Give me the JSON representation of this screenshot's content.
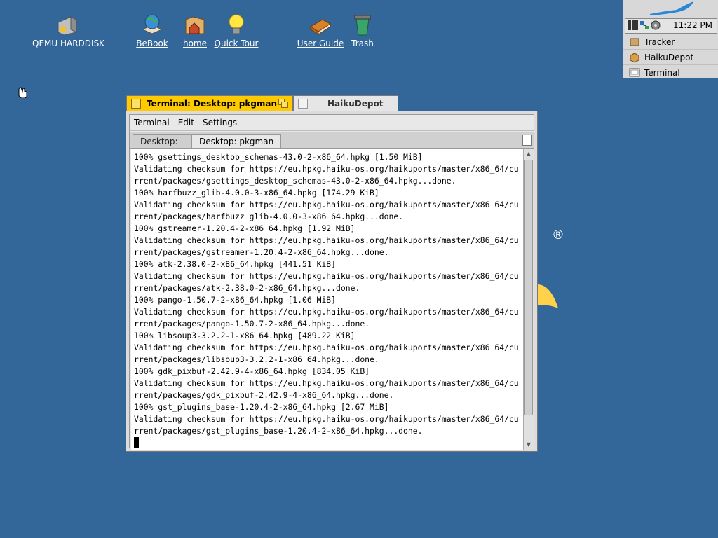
{
  "desktop": {
    "icons": [
      {
        "label": "QEMU HARDDISK",
        "icon": "harddisk-icon"
      },
      {
        "label": "BeBook",
        "icon": "bebook-icon"
      },
      {
        "label": "home",
        "icon": "home-folder-icon"
      },
      {
        "label": "Quick Tour",
        "icon": "lightbulb-icon"
      },
      {
        "label": "User Guide",
        "icon": "book-icon"
      },
      {
        "label": "Trash",
        "icon": "trash-icon"
      }
    ],
    "background": "#336699"
  },
  "deskbar": {
    "time": "11:22 PM",
    "apps": [
      {
        "label": "Tracker",
        "icon": "tracker-icon"
      },
      {
        "label": "HaikuDepot",
        "icon": "package-icon"
      },
      {
        "label": "Terminal",
        "icon": "terminal-icon"
      }
    ]
  },
  "window_tabs": [
    {
      "title": "Terminal: Desktop: pkgman",
      "active": true
    },
    {
      "title": "HaikuDepot",
      "active": false
    }
  ],
  "menu": [
    "Terminal",
    "Edit",
    "Settings"
  ],
  "terminal_tabs": [
    {
      "label": "Desktop: --",
      "active": false
    },
    {
      "label": "Desktop: pkgman",
      "active": true
    }
  ],
  "terminal_lines": [
    "100% gsettings_desktop_schemas-43.0-2-x86_64.hpkg [1.50 MiB]",
    "Validating checksum for https://eu.hpkg.haiku-os.org/haikuports/master/x86_64/cu",
    "rrent/packages/gsettings_desktop_schemas-43.0-2-x86_64.hpkg...done.",
    "100% harfbuzz_glib-4.0.0-3-x86_64.hpkg [174.29 KiB]",
    "Validating checksum for https://eu.hpkg.haiku-os.org/haikuports/master/x86_64/cu",
    "rrent/packages/harfbuzz_glib-4.0.0-3-x86_64.hpkg...done.",
    "100% gstreamer-1.20.4-2-x86_64.hpkg [1.92 MiB]",
    "Validating checksum for https://eu.hpkg.haiku-os.org/haikuports/master/x86_64/cu",
    "rrent/packages/gstreamer-1.20.4-2-x86_64.hpkg...done.",
    "100% atk-2.38.0-2-x86_64.hpkg [441.51 KiB]",
    "Validating checksum for https://eu.hpkg.haiku-os.org/haikuports/master/x86_64/cu",
    "rrent/packages/atk-2.38.0-2-x86_64.hpkg...done.",
    "100% pango-1.50.7-2-x86_64.hpkg [1.06 MiB]",
    "Validating checksum for https://eu.hpkg.haiku-os.org/haikuports/master/x86_64/cu",
    "rrent/packages/pango-1.50.7-2-x86_64.hpkg...done.",
    "100% libsoup3-3.2.2-1-x86_64.hpkg [489.22 KiB]",
    "Validating checksum for https://eu.hpkg.haiku-os.org/haikuports/master/x86_64/cu",
    "rrent/packages/libsoup3-3.2.2-1-x86_64.hpkg...done.",
    "100% gdk_pixbuf-2.42.9-4-x86_64.hpkg [834.05 KiB]",
    "Validating checksum for https://eu.hpkg.haiku-os.org/haikuports/master/x86_64/cu",
    "rrent/packages/gdk_pixbuf-2.42.9-4-x86_64.hpkg...done.",
    "100% gst_plugins_base-1.20.4-2-x86_64.hpkg [2.67 MiB]",
    "Validating checksum for https://eu.hpkg.haiku-os.org/haikuports/master/x86_64/cu",
    "rrent/packages/gst_plugins_base-1.20.4-2-x86_64.hpkg...done."
  ],
  "registered_mark": "®"
}
